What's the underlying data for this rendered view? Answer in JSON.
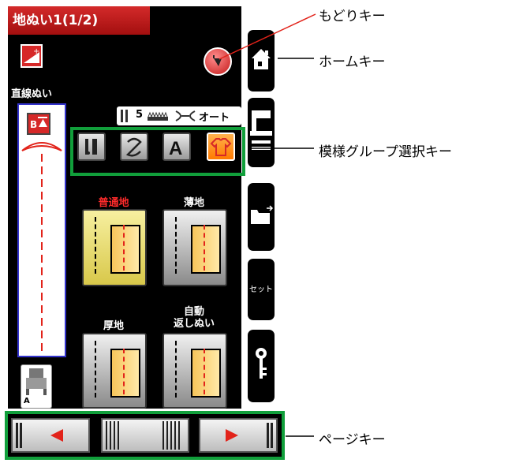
{
  "screen": {
    "title": "地ぬい1(1/2)",
    "stitch_name": "直線ぬい",
    "info": {
      "length_value": "5",
      "auto_label": "オート"
    },
    "categories": {
      "normal": "普通地",
      "thin": "薄地",
      "thick": "厚地",
      "auto_reverse_line1": "自動",
      "auto_reverse_line2": "返しぬい"
    },
    "side_buttons": {
      "set_label": "セット"
    },
    "foot_label": "A"
  },
  "annotations": {
    "back_key": "もどりキー",
    "home_key": "ホームキー",
    "pattern_group": "模様グループ選択キー",
    "page_key": "ページキー"
  },
  "colors": {
    "accent_red": "#d62828",
    "highlight_green": "#119f3b",
    "selected_orange": "#ff8c1a",
    "selected_label": "#ff2b2b"
  }
}
